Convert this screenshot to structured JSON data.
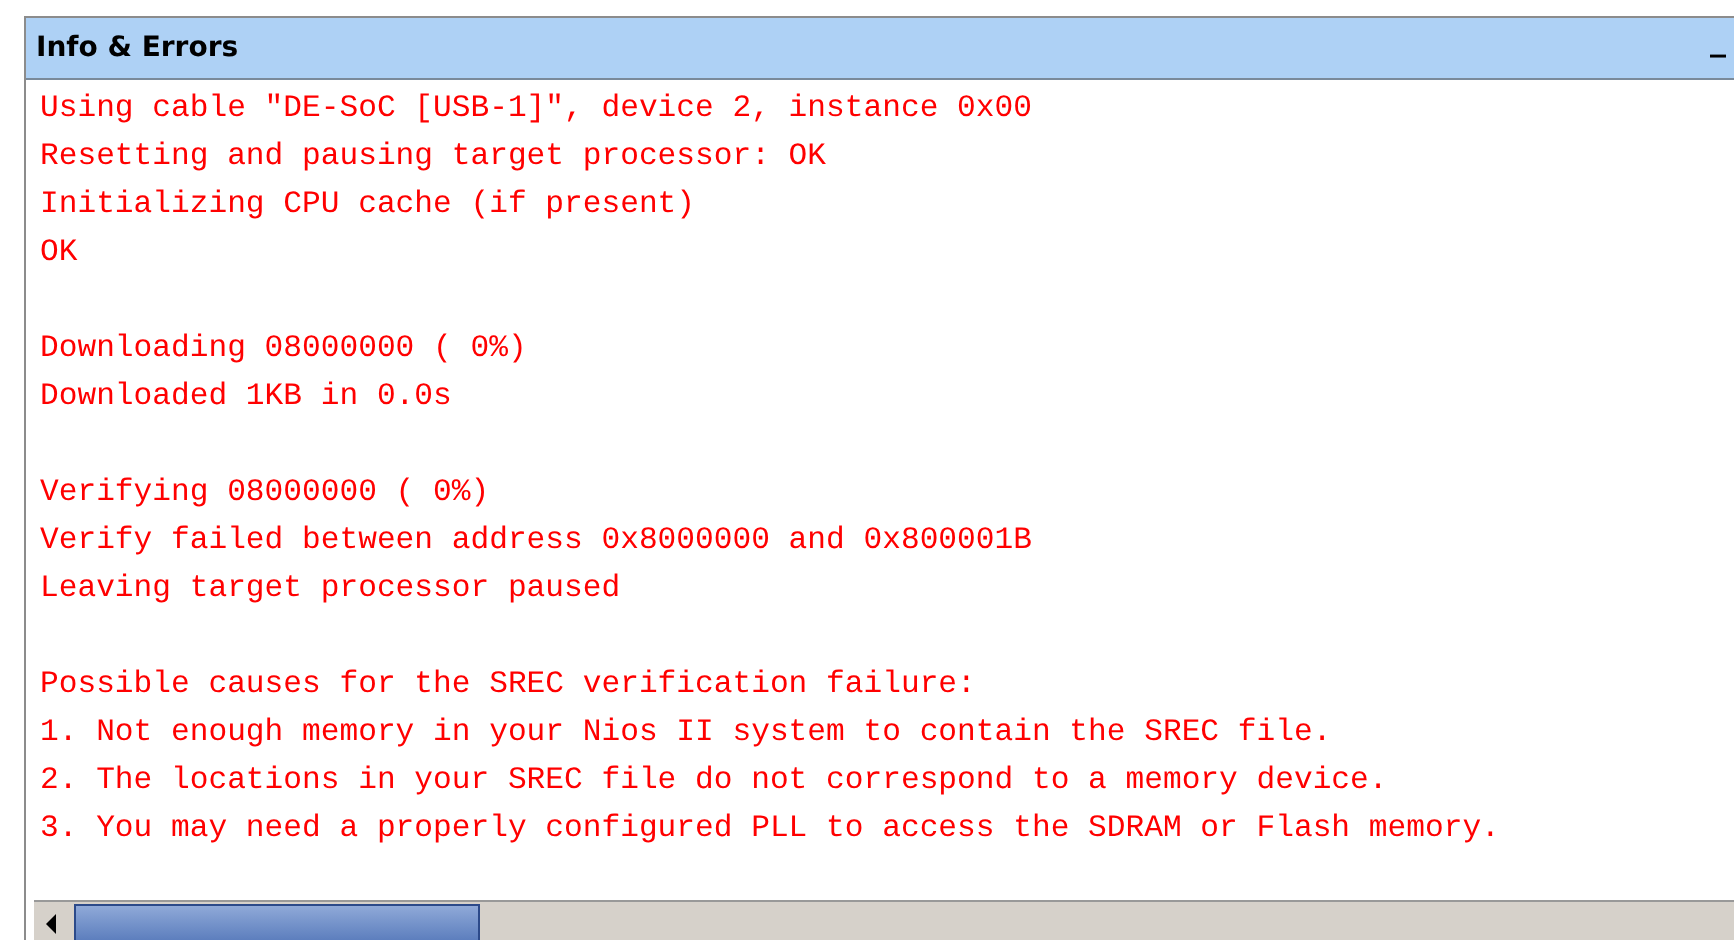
{
  "panel": {
    "title": "Info & Errors",
    "minimize": "_"
  },
  "log_blocks": [
    [
      "Using cable \"DE-SoC [USB-1]\", device 2, instance 0x00",
      "Resetting and pausing target processor: OK",
      "Initializing CPU cache (if present)",
      "OK"
    ],
    [
      "Downloading 08000000 ( 0%)",
      "Downloaded 1KB in 0.0s"
    ],
    [
      "Verifying 08000000 ( 0%)",
      "Verify failed between address 0x8000000 and 0x800001B",
      "Leaving target processor paused"
    ],
    [
      "Possible causes for the SREC verification failure:",
      "1. Not enough memory in your Nios II system to contain the SREC file.",
      "2. The locations in your SREC file do not correspond to a memory device.",
      "3. You may need a properly configured PLL to access the SDRAM or Flash memory."
    ]
  ]
}
